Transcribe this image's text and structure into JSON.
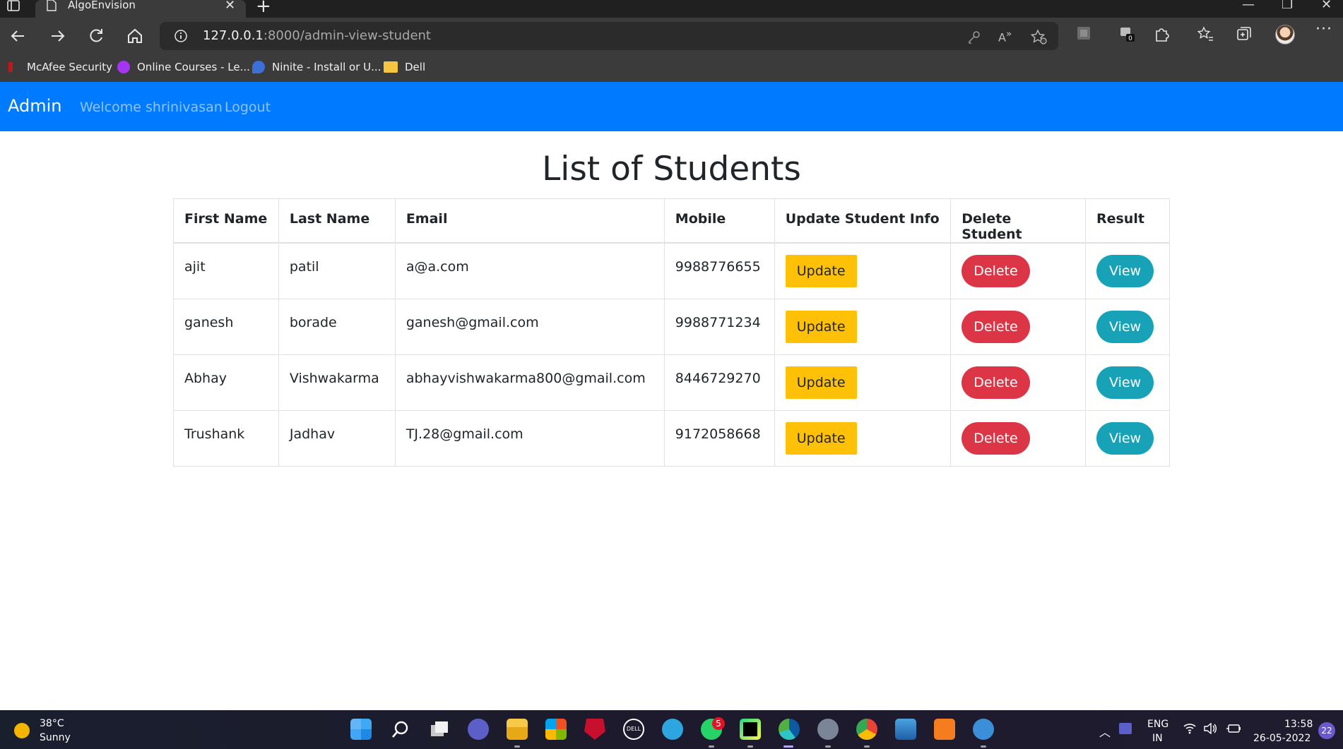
{
  "browser": {
    "tab_title": "AlgoEnvision",
    "url_host": "127.0.0.1",
    "url_path": ":8000/admin-view-student",
    "bookmarks": [
      {
        "label": "McAfee Security",
        "icon": "mcafee-icon"
      },
      {
        "label": "Online Courses - Le...",
        "icon": "udemy-icon"
      },
      {
        "label": "Ninite - Install or U...",
        "icon": "ninite-icon"
      },
      {
        "label": "Dell",
        "icon": "folder-icon"
      }
    ]
  },
  "navbar": {
    "brand": "Admin",
    "welcome": "Welcome shrinivasan",
    "logout": "Logout",
    "bg_color": "#007bff"
  },
  "page": {
    "title": "List of Students"
  },
  "table": {
    "headers": [
      "First Name",
      "Last Name",
      "Email",
      "Mobile",
      "Update Student Info",
      "Delete Student",
      "Result"
    ],
    "rows": [
      {
        "first": "ajit",
        "last": "patil",
        "email": "a@a.com",
        "mobile": "9988776655",
        "update": "Update",
        "delete": "Delete",
        "view": "View"
      },
      {
        "first": "ganesh",
        "last": "borade",
        "email": "ganesh@gmail.com",
        "mobile": "9988771234",
        "update": "Update",
        "delete": "Delete",
        "view": "View"
      },
      {
        "first": "Abhay",
        "last": "Vishwakarma",
        "email": "abhayvishwakarma800@gmail.com",
        "mobile": "8446729270",
        "update": "Update",
        "delete": "Delete",
        "view": "View"
      },
      {
        "first": "Trushank",
        "last": "Jadhav",
        "email": "TJ.28@gmail.com",
        "mobile": "9172058668",
        "update": "Update",
        "delete": "Delete",
        "view": "View"
      }
    ],
    "colors": {
      "update": "#ffc107",
      "delete": "#dc3545",
      "view": "#17a2b8"
    }
  },
  "taskbar": {
    "weather_temp": "38°C",
    "weather_desc": "Sunny",
    "whatsapp_badge": "5",
    "lang_line1": "ENG",
    "lang_line2": "IN",
    "time": "13:58",
    "date": "26-05-2022",
    "notifications": "22"
  }
}
